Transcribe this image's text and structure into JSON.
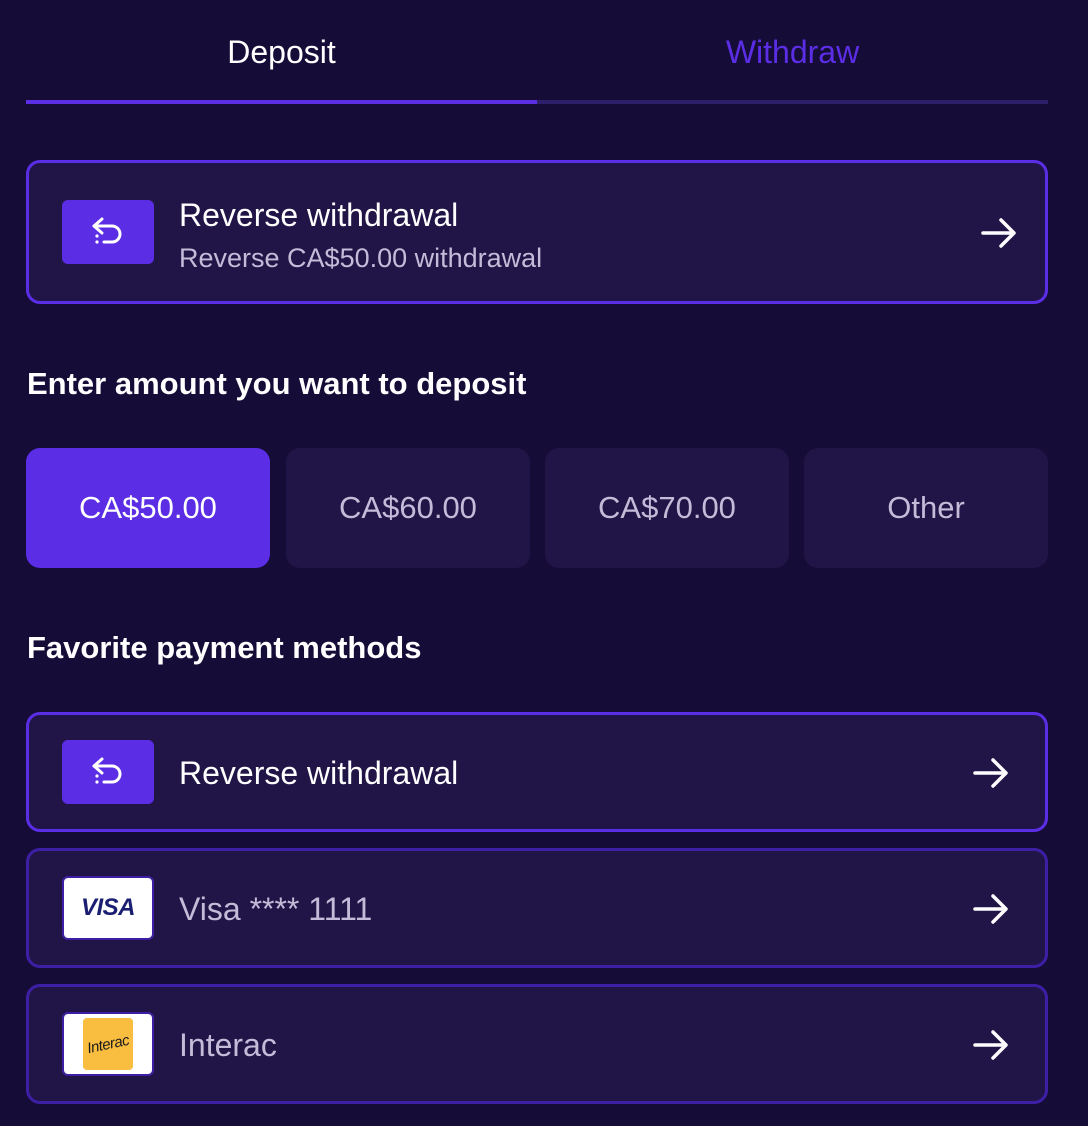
{
  "tabs": [
    {
      "label": "Deposit",
      "active": true
    },
    {
      "label": "Withdraw",
      "active": false
    }
  ],
  "reverse_card": {
    "title": "Reverse withdrawal",
    "subtitle": "Reverse CA$50.00 withdrawal",
    "icon": "undo-arrow-icon",
    "action_icon": "arrow-right-icon"
  },
  "amount_section": {
    "title": "Enter amount you want to deposit",
    "options": [
      {
        "label": "CA$50.00",
        "selected": true
      },
      {
        "label": "CA$60.00",
        "selected": false
      },
      {
        "label": "CA$70.00",
        "selected": false
      },
      {
        "label": "Other",
        "selected": false
      }
    ]
  },
  "methods_section": {
    "title": "Favorite payment methods",
    "methods": [
      {
        "label": "Reverse withdrawal",
        "icon": "undo-arrow-icon",
        "highlighted": true
      },
      {
        "label": "Visa **** 1111",
        "icon": "visa-logo",
        "logo_text": "VISA",
        "highlighted": false
      },
      {
        "label": "Interac",
        "icon": "interac-logo",
        "logo_text": "Interac",
        "highlighted": false
      }
    ]
  },
  "colors": {
    "background": "#150c37",
    "card": "#211446",
    "accent": "#5b2ee6",
    "muted_text": "#c3bcd9"
  }
}
